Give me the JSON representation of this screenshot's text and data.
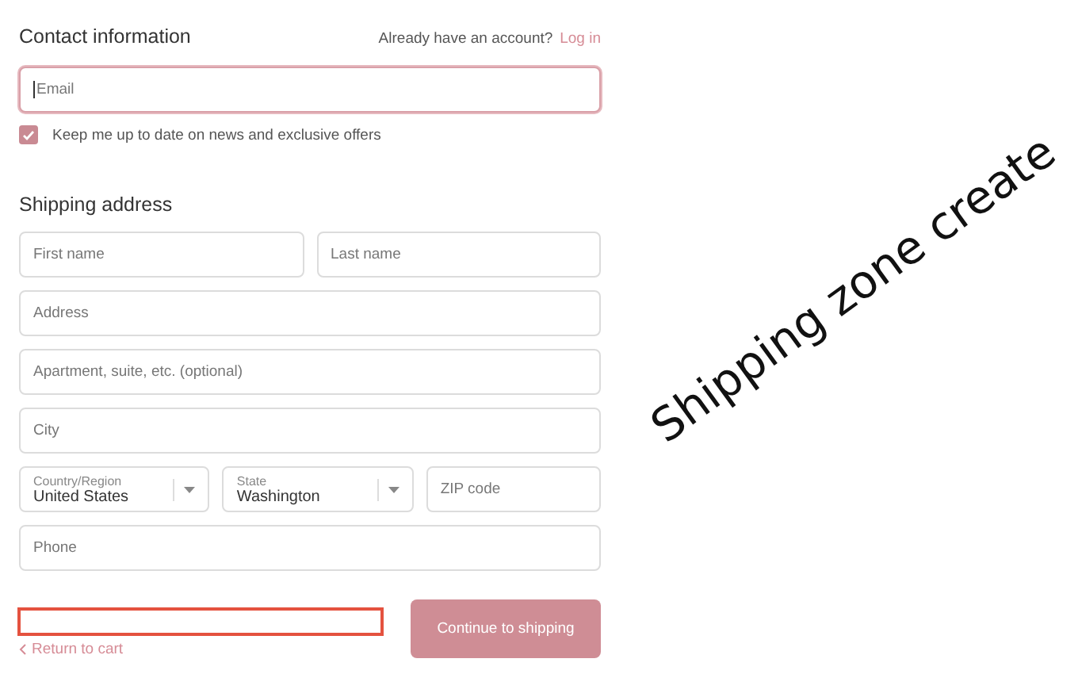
{
  "contact": {
    "title": "Contact information",
    "account_prompt": "Already have an account?",
    "login_link": "Log in",
    "email": {
      "placeholder": "Email",
      "focused": true
    },
    "newsletter": {
      "label": "Keep me up to date on news and exclusive offers",
      "checked": true
    }
  },
  "shipping": {
    "title": "Shipping address",
    "rows": [
      [
        {
          "kind": "text",
          "placeholder": "First name"
        },
        {
          "kind": "text",
          "placeholder": "Last name"
        }
      ],
      [
        {
          "kind": "text",
          "placeholder": "Address"
        }
      ],
      [
        {
          "kind": "text",
          "placeholder": "Apartment, suite, etc. (optional)"
        }
      ],
      [
        {
          "kind": "text",
          "placeholder": "City"
        }
      ],
      [
        {
          "kind": "select",
          "label": "Country/Region",
          "value": "United States"
        },
        {
          "kind": "select",
          "label": "State",
          "value": "Washington"
        },
        {
          "kind": "text",
          "placeholder": "ZIP code"
        }
      ],
      [
        {
          "kind": "text",
          "placeholder": "Phone"
        }
      ]
    ]
  },
  "footer": {
    "return_link": "Return to cart",
    "continue_button": "Continue to shipping"
  },
  "annotations": [
    {
      "kind": "box"
    },
    {
      "kind": "text",
      "text": "Shipping zone create"
    }
  ]
}
